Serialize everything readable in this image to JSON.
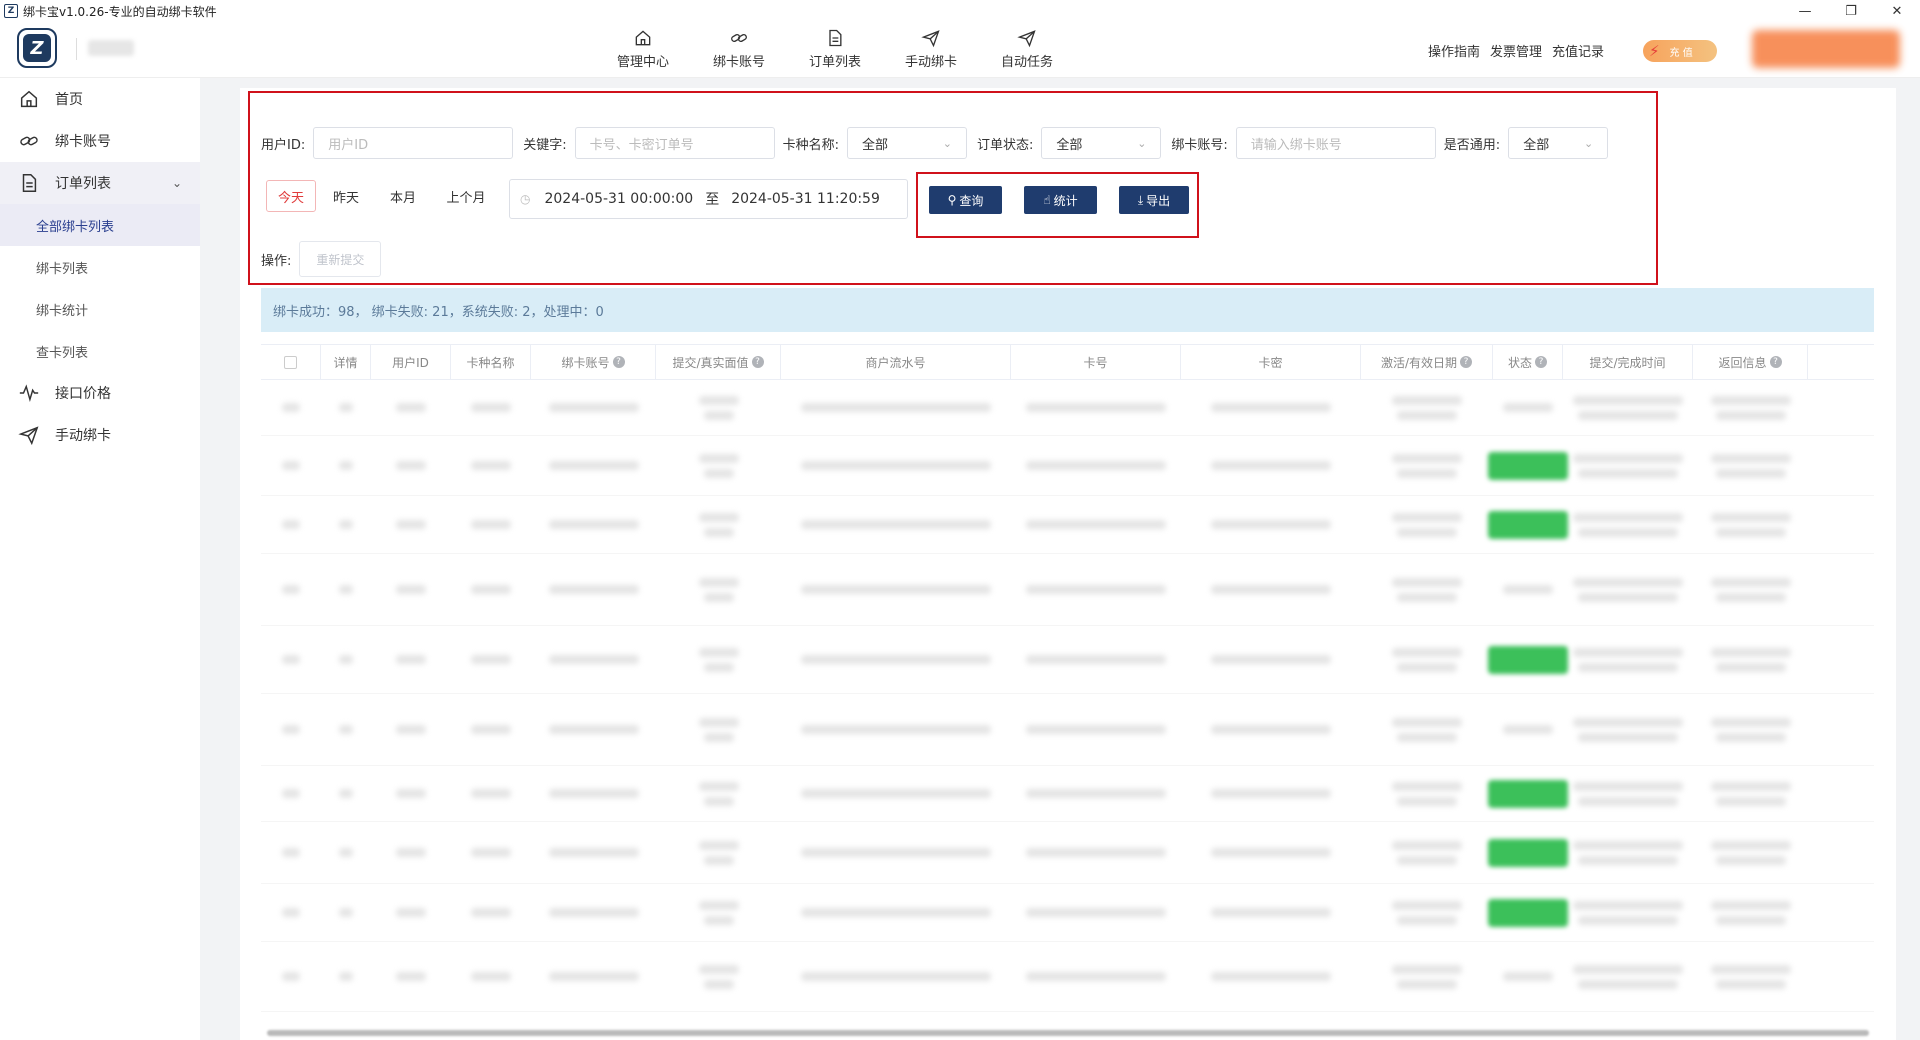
{
  "window": {
    "title": "绑卡宝v1.0.26-专业的自动绑卡软件",
    "app_icon": "Z",
    "controls": {
      "minimize": "—",
      "maximize": "❐",
      "close": "✕"
    }
  },
  "logo": {
    "letter": "Z"
  },
  "topnav": {
    "items": [
      {
        "label": "管理中心",
        "icon": "home-icon"
      },
      {
        "label": "绑卡账号",
        "icon": "link-icon"
      },
      {
        "label": "订单列表",
        "icon": "document-icon"
      },
      {
        "label": "手动绑卡",
        "icon": "send-icon"
      },
      {
        "label": "自动任务",
        "icon": "send-icon"
      }
    ],
    "links": [
      "操作指南",
      "发票管理",
      "充值记录"
    ],
    "recharge_label": "充 值"
  },
  "sidebar": {
    "items": [
      {
        "label": "首页",
        "icon": "home-icon"
      },
      {
        "label": "绑卡账号",
        "icon": "link-icon"
      },
      {
        "label": "订单列表",
        "icon": "document-icon",
        "expanded": true
      },
      {
        "label": "接口价格",
        "icon": "pulse-icon"
      },
      {
        "label": "手动绑卡",
        "icon": "send-icon"
      }
    ],
    "subitems": [
      "全部绑卡列表",
      "绑卡列表",
      "绑卡统计",
      "查卡列表"
    ],
    "active_subitem": "全部绑卡列表"
  },
  "filters": {
    "user_id": {
      "label": "用户ID:",
      "placeholder": "用户ID"
    },
    "keyword": {
      "label": "关键字:",
      "placeholder": "卡号、卡密订单号"
    },
    "card_type": {
      "label": "卡种名称:",
      "value": "全部"
    },
    "order_status": {
      "label": "订单状态:",
      "value": "全部"
    },
    "bind_account": {
      "label": "绑卡账号:",
      "placeholder": "请输入绑卡账号"
    },
    "is_universal": {
      "label": "是否通用:",
      "value": "全部"
    },
    "date_buttons": [
      "今天",
      "昨天",
      "本月",
      "上个月"
    ],
    "active_date_button": "今天",
    "date_start": "2024-05-31 00:00:00",
    "date_to": "至",
    "date_end": "2024-05-31 11:20:59",
    "buttons": {
      "query": "查询",
      "stats": "统计",
      "export": "导出"
    },
    "operation_label": "操作:",
    "resubmit_label": "重新提交"
  },
  "summary": "绑卡成功：98， 绑卡失败: 21，系统失败: 2，处理中：0",
  "table": {
    "columns": [
      "详情",
      "用户ID",
      "卡种名称",
      "绑卡账号",
      "提交/真实面值",
      "商户流水号",
      "卡号",
      "卡密",
      "激活/有效日期",
      "状态",
      "提交/完成时间",
      "返回信息"
    ],
    "help_columns": [
      "绑卡账号",
      "提交/真实面值",
      "激活/有效日期",
      "状态",
      "返回信息"
    ],
    "rows": [
      {
        "status": "other"
      },
      {
        "status": "success"
      },
      {
        "status": "success"
      },
      {
        "status": "other"
      },
      {
        "status": "success"
      },
      {
        "status": "other"
      },
      {
        "status": "success"
      },
      {
        "status": "success"
      },
      {
        "status": "success"
      },
      {
        "status": "other"
      }
    ]
  },
  "colors": {
    "primary": "#1f3c6e",
    "highlight": "#d0111b",
    "success": "#3cc05a",
    "info_bg": "#d9edf7"
  }
}
